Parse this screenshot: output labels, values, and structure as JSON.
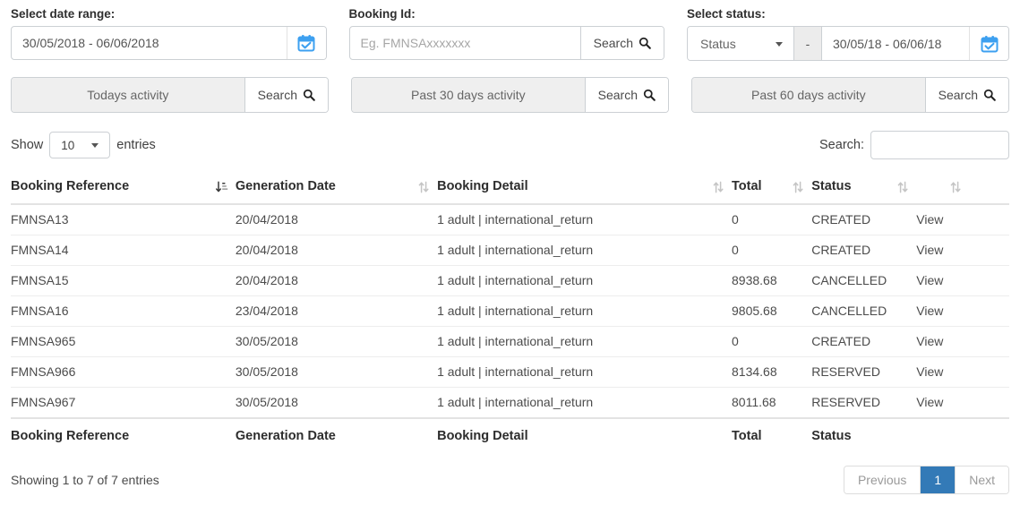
{
  "filters": [
    {
      "label": "Select date range:",
      "kind": "daterange",
      "value": "30/05/2018 - 06/06/2018",
      "placeholder": "",
      "icon": "calendar-check-icon"
    },
    {
      "label": "Booking Id:",
      "kind": "search",
      "value": "",
      "placeholder": "Eg. FMNSAxxxxxxx",
      "button_label": "Search",
      "icon": "search-icon"
    },
    {
      "label": "Select status:",
      "kind": "status-daterange",
      "select_value": "Status",
      "separator": "-",
      "value": "30/05/18 - 06/06/18",
      "placeholder": "",
      "icon": "calendar-check-icon"
    }
  ],
  "activity_buttons": [
    {
      "label": "Todays activity",
      "button_label": "Search"
    },
    {
      "label": "Past 30 days activity",
      "button_label": "Search"
    },
    {
      "label": "Past 60 days activity",
      "button_label": "Search"
    }
  ],
  "table_controls": {
    "show_prefix": "Show",
    "entries_value": "10",
    "show_suffix": "entries",
    "search_label": "Search:",
    "search_value": "",
    "search_placeholder": ""
  },
  "table": {
    "columns": [
      {
        "label": "Booking Reference",
        "sort": "sort-amount-down-icon"
      },
      {
        "label": "Generation Date",
        "sort": "sort-icon"
      },
      {
        "label": "Booking Detail",
        "sort": "sort-icon"
      },
      {
        "label": "Total",
        "sort": "sort-icon"
      },
      {
        "label": "Status",
        "sort": "sort-icon"
      },
      {
        "label": "",
        "sort": "sort-icon"
      },
      {
        "label": "",
        "sort": ""
      }
    ],
    "footer_columns": [
      "Booking Reference",
      "Generation Date",
      "Booking Detail",
      "Total",
      "Status",
      "",
      ""
    ],
    "rows": [
      {
        "reference": "FMNSA13",
        "generation_date": "20/04/2018",
        "detail": "1 adult | international_return",
        "total": "0",
        "status": "CREATED",
        "action": "View"
      },
      {
        "reference": "FMNSA14",
        "generation_date": "20/04/2018",
        "detail": "1 adult | international_return",
        "total": "0",
        "status": "CREATED",
        "action": "View"
      },
      {
        "reference": "FMNSA15",
        "generation_date": "20/04/2018",
        "detail": "1 adult | international_return",
        "total": "8938.68",
        "status": "CANCELLED",
        "action": "View"
      },
      {
        "reference": "FMNSA16",
        "generation_date": "23/04/2018",
        "detail": "1 adult | international_return",
        "total": "9805.68",
        "status": "CANCELLED",
        "action": "View"
      },
      {
        "reference": "FMNSA965",
        "generation_date": "30/05/2018",
        "detail": "1 adult | international_return",
        "total": "0",
        "status": "CREATED",
        "action": "View"
      },
      {
        "reference": "FMNSA966",
        "generation_date": "30/05/2018",
        "detail": "1 adult | international_return",
        "total": "8134.68",
        "status": "RESERVED",
        "action": "View"
      },
      {
        "reference": "FMNSA967",
        "generation_date": "30/05/2018",
        "detail": "1 adult | international_return",
        "total": "8011.68",
        "status": "RESERVED",
        "action": "View"
      }
    ]
  },
  "table_footer": {
    "info": "Showing 1 to 7 of 7 entries",
    "pagination": {
      "previous": "Previous",
      "pages": [
        "1"
      ],
      "active_page": "1",
      "next": "Next"
    }
  },
  "colors": {
    "accent": "#337ab7",
    "calendar_icon": "#3da0f0",
    "border": "#ccd0d4",
    "muted_text": "#a6a6a6"
  }
}
